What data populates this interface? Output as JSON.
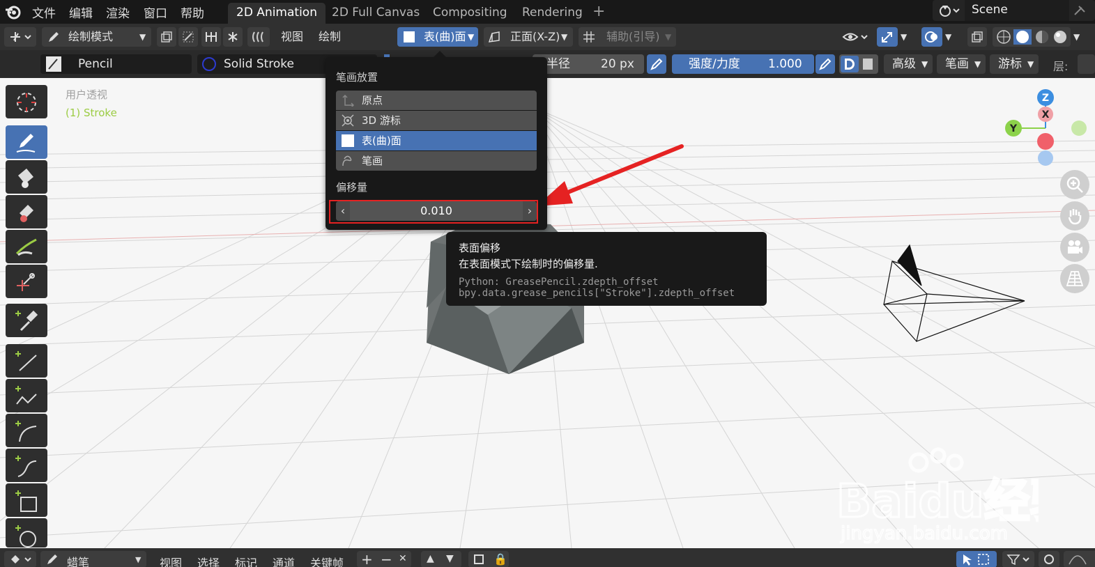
{
  "menu": [
    "文件",
    "编辑",
    "渲染",
    "窗口",
    "帮助"
  ],
  "workspaces": [
    "2D Animation",
    "2D Full Canvas",
    "Compositing",
    "Rendering"
  ],
  "add_workspace": "+",
  "scene": "Scene",
  "header": {
    "mode": "绘制模式",
    "view": "视图",
    "draw": "绘制",
    "placement": "表(曲)面",
    "orientation": "正面(X-Z)",
    "guides": "辅助(引导)"
  },
  "tool_settings": {
    "brush": "Pencil",
    "material": "Solid Stroke",
    "radius_label": "半径",
    "radius_value": "20 px",
    "strength_label": "强度/力度",
    "strength_value": "1.000",
    "advanced": "高级",
    "stroke": "笔画",
    "cursor": "游标",
    "layer": "层:"
  },
  "viewport": {
    "view_name": "用户透视",
    "object_name": "(1) Stroke"
  },
  "popup": {
    "title": "笔画放置",
    "options": [
      "原点",
      "3D 游标",
      "表(曲)面",
      "笔画"
    ],
    "selected_index": 2,
    "offset_label": "偏移量",
    "offset_value": "0.010"
  },
  "tooltip": {
    "title": "表面偏移",
    "description": "在表面模式下绘制时的偏移量.",
    "python": "Python: GreasePencil.zdepth_offset",
    "data_path": "bpy.data.grease_pencils[\"Stroke\"].zdepth_offset"
  },
  "gizmo": {
    "z": "Z",
    "x": "X",
    "y": "Y"
  },
  "bottom": {
    "editor": "蜡笔",
    "items": [
      "视图",
      "选择",
      "标记",
      "通道",
      "关键帧"
    ]
  },
  "watermark": {
    "brand": "Baidu经验",
    "url": "jingyan.baidu.com"
  },
  "colors": {
    "accent": "#4772b3",
    "annotation_red": "#e52222",
    "object_name": "#9ccc44"
  }
}
